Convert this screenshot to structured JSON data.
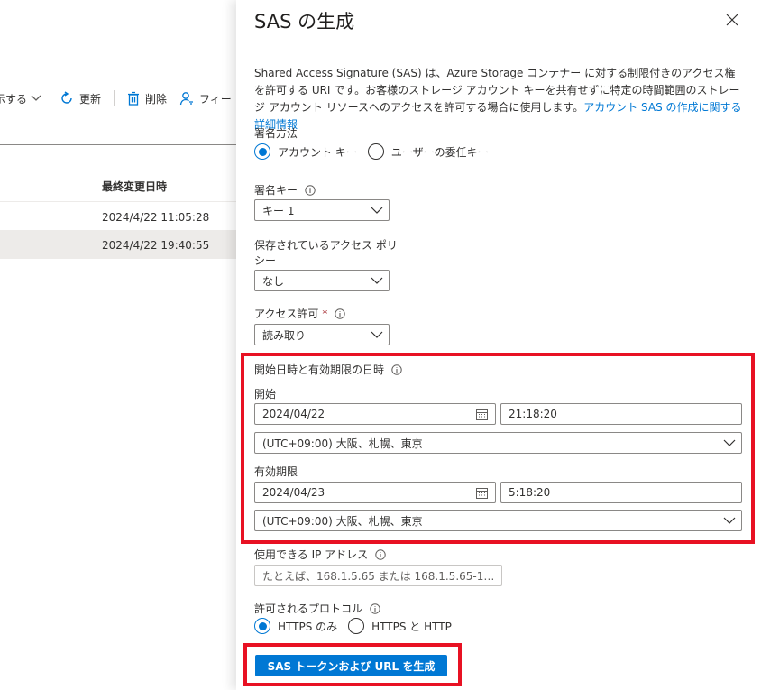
{
  "background": {
    "toolbar": {
      "partial_label": "示する",
      "refresh_label": "更新",
      "delete_label": "削除",
      "filter_label": "フィー"
    },
    "table": {
      "column_header": "最終変更日時",
      "rows": [
        {
          "modified": "2024/4/22 11:05:28"
        },
        {
          "modified": "2024/4/22 19:40:55"
        }
      ]
    }
  },
  "panel": {
    "title": "SAS の生成",
    "description": "Shared Access Signature (SAS) は、Azure Storage コンテナー に対する制限付きのアクセス権を許可する URI です。お客様のストレージ アカウント キーを共有せずに特定の時間範囲のストレージ アカウント リソースへのアクセスを許可する場合に使用します。",
    "description_link": "アカウント SAS の作成に関する詳細情報",
    "signing_method": {
      "label": "署名方法",
      "options": [
        "アカウント キー",
        "ユーザーの委任キー"
      ],
      "selected": "アカウント キー"
    },
    "signing_key": {
      "label": "署名キー",
      "value": "キー 1"
    },
    "stored_policy": {
      "label_line1": "保存されているアクセス ポリ",
      "label_line2": "シー",
      "value": "なし"
    },
    "permissions": {
      "label": "アクセス許可",
      "required_mark": "*",
      "value": "読み取り"
    },
    "datetime_section": {
      "label": "開始日時と有効期限の日時",
      "start_label": "開始",
      "start_date": "2024/04/22",
      "start_time": "21:18:20",
      "start_timezone": "(UTC+09:00) 大阪、札幌、東京",
      "expiry_label": "有効期限",
      "expiry_date": "2024/04/23",
      "expiry_time": "5:18:20",
      "expiry_timezone": "(UTC+09:00) 大阪、札幌、東京"
    },
    "allowed_ip": {
      "label": "使用できる IP アドレス",
      "placeholder": "たとえば、168.1.5.65 または 168.1.5.65-1…"
    },
    "protocols": {
      "label": "許可されるプロトコル",
      "options": [
        "HTTPS のみ",
        "HTTPS と HTTP"
      ],
      "selected": "HTTPS のみ"
    },
    "generate_button": "SAS トークンおよび URL を生成"
  },
  "colors": {
    "accent": "#0078d4",
    "highlight": "#e81123"
  }
}
